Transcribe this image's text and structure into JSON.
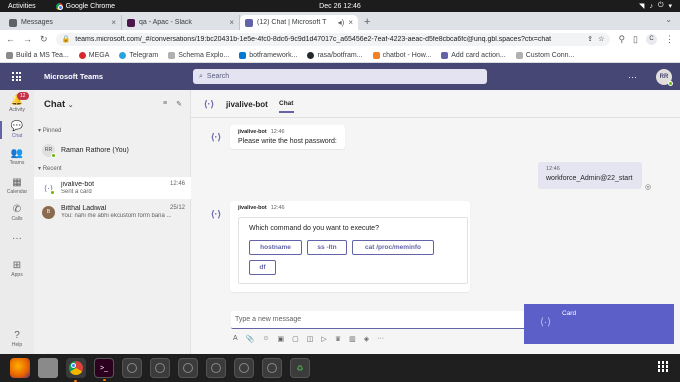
{
  "system_bar": {
    "activities": "Activities",
    "app": "Google Chrome",
    "clock": "Dec 26  12:46"
  },
  "tabs": [
    {
      "title": "Messages",
      "color": "#5f6368",
      "active": false
    },
    {
      "title": "qa - Apac - Slack",
      "color": "#4a154b",
      "active": false
    },
    {
      "title": "(12) Chat | Microsoft T",
      "color": "#6264a7",
      "active": true
    }
  ],
  "address_bar": {
    "url": "teams.microsoft.com/_#/conversations/19:bc20431b-1e5e-4fc0-8dc6-9c9d1d47017c_a65456e2-7eaf-4223-aeac-d5fe8cbca6fc@unq.gbl.spaces?ctx=chat",
    "profile": "C"
  },
  "bookmarks": [
    {
      "label": "Build a MS Tea...",
      "color": "#e1e1e1"
    },
    {
      "label": "MEGA",
      "color": "#d9272e"
    },
    {
      "label": "Telegram",
      "color": "#2aa3dd"
    },
    {
      "label": "Schema Explo...",
      "color": "#b0b0b0"
    },
    {
      "label": "botframework...",
      "color": "#0078d4"
    },
    {
      "label": "rasa/botfram...",
      "color": "#24292e"
    },
    {
      "label": "chatbot - How...",
      "color": "#f48024"
    },
    {
      "label": "Add card action...",
      "color": "#6264a7"
    },
    {
      "label": "Custom Conn...",
      "color": "#b0b0b0"
    }
  ],
  "teams": {
    "brand": "Microsoft Teams",
    "search_placeholder": "Search",
    "user_initials": "RR"
  },
  "rail": [
    {
      "label": "Activity",
      "icon": "bell-icon",
      "glyph": "🔔",
      "badge": "12"
    },
    {
      "label": "Chat",
      "icon": "chat-icon",
      "glyph": "💬",
      "active": true
    },
    {
      "label": "Teams",
      "icon": "teams-icon",
      "glyph": "👥"
    },
    {
      "label": "Calendar",
      "icon": "calendar-icon",
      "glyph": "▦"
    },
    {
      "label": "Calls",
      "icon": "phone-icon",
      "glyph": "✆"
    },
    {
      "label": "",
      "icon": "more-icon",
      "glyph": "···"
    },
    {
      "label": "Apps",
      "icon": "apps-icon",
      "glyph": "⊞"
    },
    {
      "label": "Help",
      "icon": "help-icon",
      "glyph": "?"
    }
  ],
  "chat_list": {
    "title": "Chat",
    "pinned_label": "Pinned",
    "recent_label": "Recent",
    "pinned": [
      {
        "name": "Raman Rathore (You)",
        "initials": "RR"
      }
    ],
    "recent": [
      {
        "name": "jivalive-bot",
        "preview": "Sent a card",
        "time": "12:46",
        "selected": true
      },
      {
        "name": "Bitthal Ladiwal",
        "preview": "You: nahi me abhi ekcustom form bana ...",
        "time": "25/12"
      }
    ]
  },
  "conversation": {
    "title": "jivalive-bot",
    "tab": "Chat",
    "msg1": {
      "sender": "jivalive-bot",
      "time": "12:46",
      "text": "Please write the host password:"
    },
    "msg2": {
      "time": "12:46",
      "text": "workforce_Admin@22_start"
    },
    "msg3": {
      "sender": "jivalive-bot",
      "time": "12:46",
      "question": "Which command do you want to execute?"
    },
    "buttons": [
      "hostname",
      "ss -ltn",
      "cat /proc/meminfo",
      "df"
    ],
    "compose_placeholder": "Type a new message",
    "popup_label": "Card"
  }
}
